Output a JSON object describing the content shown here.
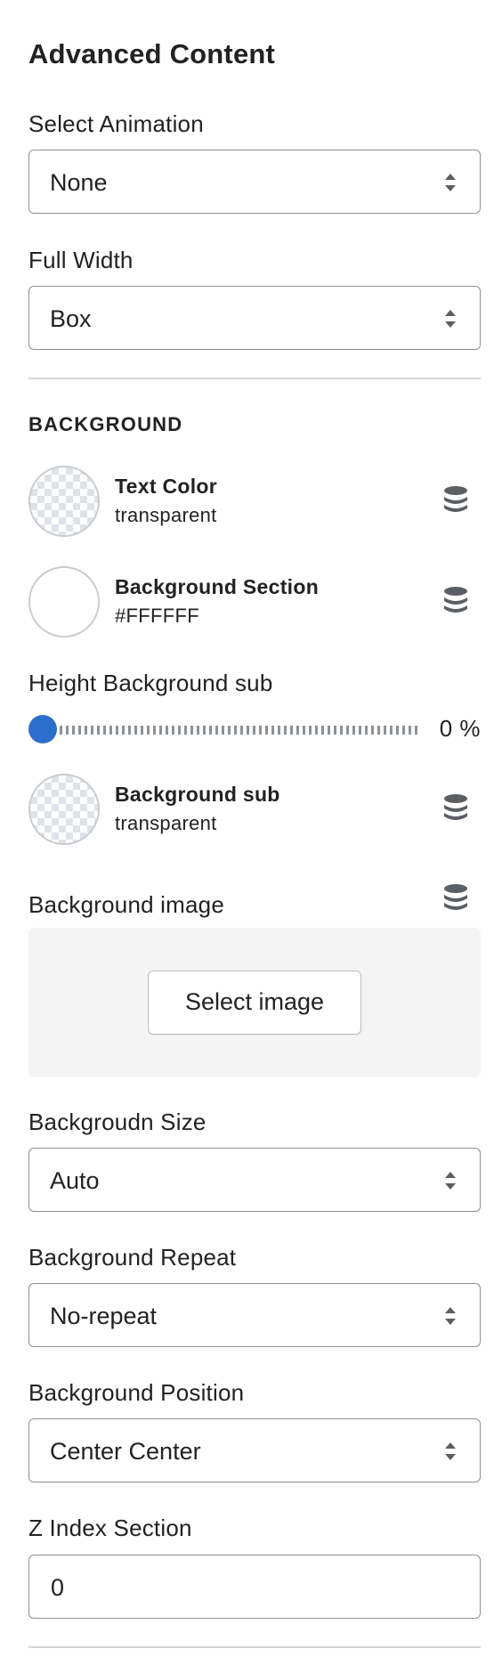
{
  "panel": {
    "title": "Advanced Content"
  },
  "animation": {
    "label": "Select Animation",
    "value": "None"
  },
  "full_width": {
    "label": "Full Width",
    "value": "Box"
  },
  "background": {
    "heading": "BACKGROUND",
    "text_color": {
      "name": "Text Color",
      "value": "transparent"
    },
    "section_color": {
      "name": "Background Section",
      "value": "#FFFFFF"
    },
    "height_sub": {
      "label": "Height Background sub",
      "value": 0,
      "display": "0 %"
    },
    "sub_color": {
      "name": "Background sub",
      "value": "transparent"
    },
    "image": {
      "label": "Background image",
      "button_label": "Select image"
    },
    "size": {
      "label": "Backgroudn Size",
      "value": "Auto"
    },
    "repeat": {
      "label": "Background Repeat",
      "value": "No-repeat"
    },
    "position": {
      "label": "Background Position",
      "value": "Center Center"
    }
  },
  "z_index": {
    "label": "Z Index Section",
    "value": "0"
  },
  "colors": {
    "accent": "#2C6ECB",
    "border": "#8C9196",
    "divider": "#D2D5D8",
    "dropzone_bg": "#F4F4F4",
    "icon": "#5C5F62"
  },
  "icons": {
    "dynamic_source": "database-icon",
    "select_arrows": "select-arrows-icon"
  }
}
